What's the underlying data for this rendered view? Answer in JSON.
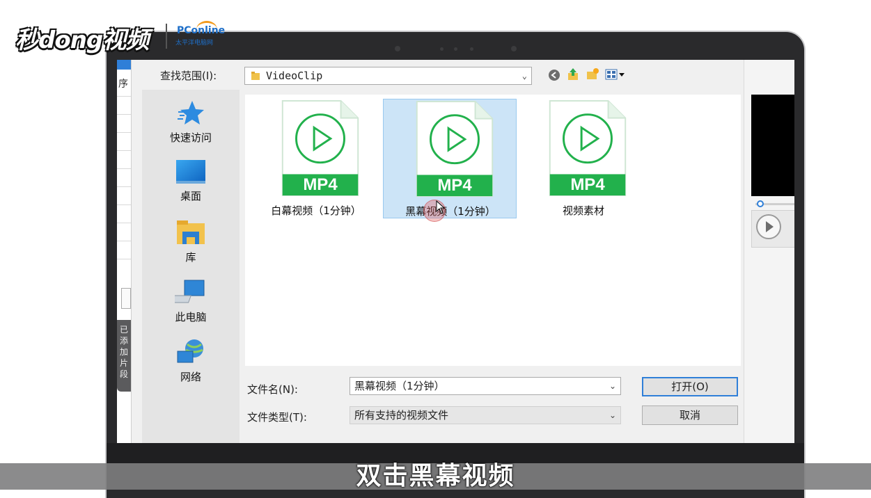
{
  "watermark": {
    "logo_text": "秒dong视频",
    "partner_name": "PConline",
    "partner_sub": "太平洋电脑网"
  },
  "app": {
    "side_label": "序",
    "side_tab": "已添加片段"
  },
  "dialog": {
    "lookin_label": "查找范围(I):",
    "lookin_value": "VideoClip",
    "places": [
      {
        "label": "快速访问",
        "icon": "star-icon"
      },
      {
        "label": "桌面",
        "icon": "desktop-icon"
      },
      {
        "label": "库",
        "icon": "library-folder-icon"
      },
      {
        "label": "此电脑",
        "icon": "computer-icon"
      },
      {
        "label": "网络",
        "icon": "network-icon"
      }
    ],
    "files": [
      {
        "name": "白幕视频（1分钟）",
        "badge": "MP4",
        "selected": false
      },
      {
        "name": "黑幕视频（1分钟）",
        "badge": "MP4",
        "selected": true
      },
      {
        "name": "视频素材",
        "badge": "MP4",
        "selected": false
      }
    ],
    "filename_label": "文件名(N):",
    "filename_value": "黑幕视频（1分钟）",
    "filetype_label": "文件类型(T):",
    "filetype_value": "所有支持的视频文件",
    "open_button": "打开(O)",
    "cancel_button": "取消",
    "colors": {
      "accent": "#2f7fd8",
      "mp4_green": "#22b14c",
      "selection": "#cce4f7"
    }
  },
  "caption": "双击黑幕视频"
}
